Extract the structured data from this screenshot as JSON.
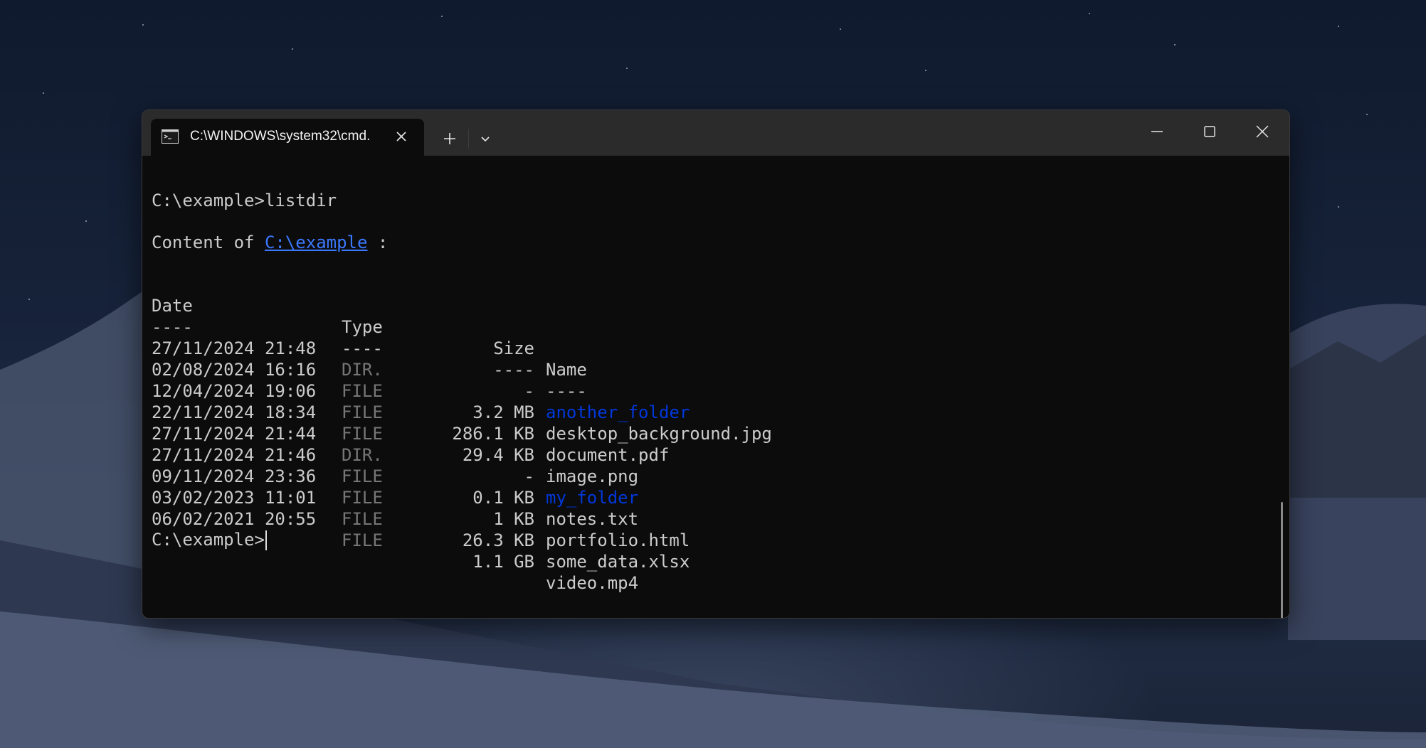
{
  "window": {
    "tab_title": "C:\\WINDOWS\\system32\\cmd.",
    "icons": [
      "terminal-icon",
      "close-icon",
      "plus-icon",
      "chevron-down-icon",
      "minimize-icon",
      "maximize-icon",
      "close-icon"
    ]
  },
  "terminal": {
    "command_line": "C:\\example>listdir",
    "content_prefix": "Content of ",
    "content_path": "C:\\example",
    "content_suffix": " :",
    "headers": {
      "date": "Date",
      "type": "Type",
      "size": "Size",
      "name": "Name"
    },
    "separators": {
      "date": "----",
      "type": "----",
      "size": "----",
      "name": "----"
    },
    "rows": [
      {
        "date": "27/11/2024 21:48",
        "type": "DIR.",
        "size": "-",
        "name": "another_folder"
      },
      {
        "date": "02/08/2024 16:16",
        "type": "FILE",
        "size": "3.2 MB",
        "name": "desktop_background.jpg"
      },
      {
        "date": "12/04/2024 19:06",
        "type": "FILE",
        "size": "286.1 KB",
        "name": "document.pdf"
      },
      {
        "date": "22/11/2024 18:34",
        "type": "FILE",
        "size": "29.4 KB",
        "name": "image.png"
      },
      {
        "date": "27/11/2024 21:44",
        "type": "DIR.",
        "size": "-",
        "name": "my_folder"
      },
      {
        "date": "27/11/2024 21:46",
        "type": "FILE",
        "size": "0.1 KB",
        "name": "notes.txt"
      },
      {
        "date": "09/11/2024 23:36",
        "type": "FILE",
        "size": "1 KB",
        "name": "portfolio.html"
      },
      {
        "date": "03/02/2023 11:01",
        "type": "FILE",
        "size": "26.3 KB",
        "name": "some_data.xlsx"
      },
      {
        "date": "06/02/2021 20:55",
        "type": "FILE",
        "size": "1.1 GB",
        "name": "video.mp4"
      }
    ],
    "prompt": "C:\\example>"
  },
  "colors": {
    "terminal_bg": "#0c0c0c",
    "text": "#cccccc",
    "dim_text": "#767676",
    "dir_name": "#0037da",
    "link": "#3b78ff",
    "titlebar": "#2b2b2b"
  }
}
